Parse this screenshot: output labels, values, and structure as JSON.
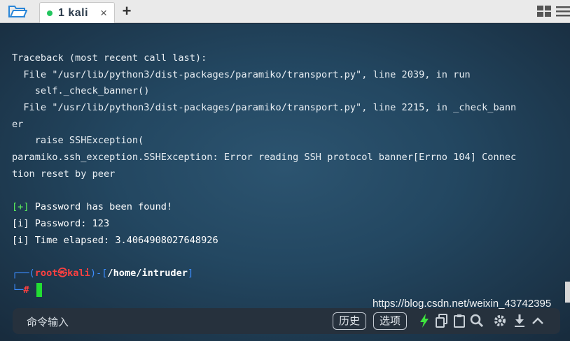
{
  "tabbar": {
    "tab_number": "1",
    "tab_title": "kali",
    "close_glyph": "×",
    "add_glyph": "+",
    "status_color": "#22c55e"
  },
  "terminal": {
    "lines": [
      "Traceback (most recent call last):",
      "  File \"/usr/lib/python3/dist-packages/paramiko/transport.py\", line 2039, in run",
      "    self._check_banner()",
      "  File \"/usr/lib/python3/dist-packages/paramiko/transport.py\", line 2215, in _check_bann",
      "er",
      "    raise SSHException(",
      "paramiko.ssh_exception.SSHException: Error reading SSH protocol banner[Errno 104] Connec",
      "tion reset by peer"
    ],
    "found": {
      "tag": "[+]",
      "text": " Password has been found!"
    },
    "password": {
      "tag": "[i]",
      "text": " Password: 123"
    },
    "elapsed": {
      "tag": "[i]",
      "text": " Time elapsed: 3.4064908027648926"
    },
    "prompt": {
      "corner_top": "┌──(",
      "user": "root㉿kali",
      "mid": ")-[",
      "path": "/home/intruder",
      "close": "]",
      "corner_bottom": "└─",
      "symbol": "#"
    }
  },
  "cmdbar": {
    "placeholder": "命令输入",
    "history_label": "历史",
    "options_label": "选项"
  },
  "watermark": "https://blog.csdn.net/weixin_43742395",
  "icons": [
    "folder-icon",
    "layout-grid-icon",
    "menu-icon",
    "lightning-icon",
    "copy-icon",
    "clipboard-icon",
    "search-icon",
    "gear-icon",
    "download-icon",
    "collapse-icon"
  ]
}
